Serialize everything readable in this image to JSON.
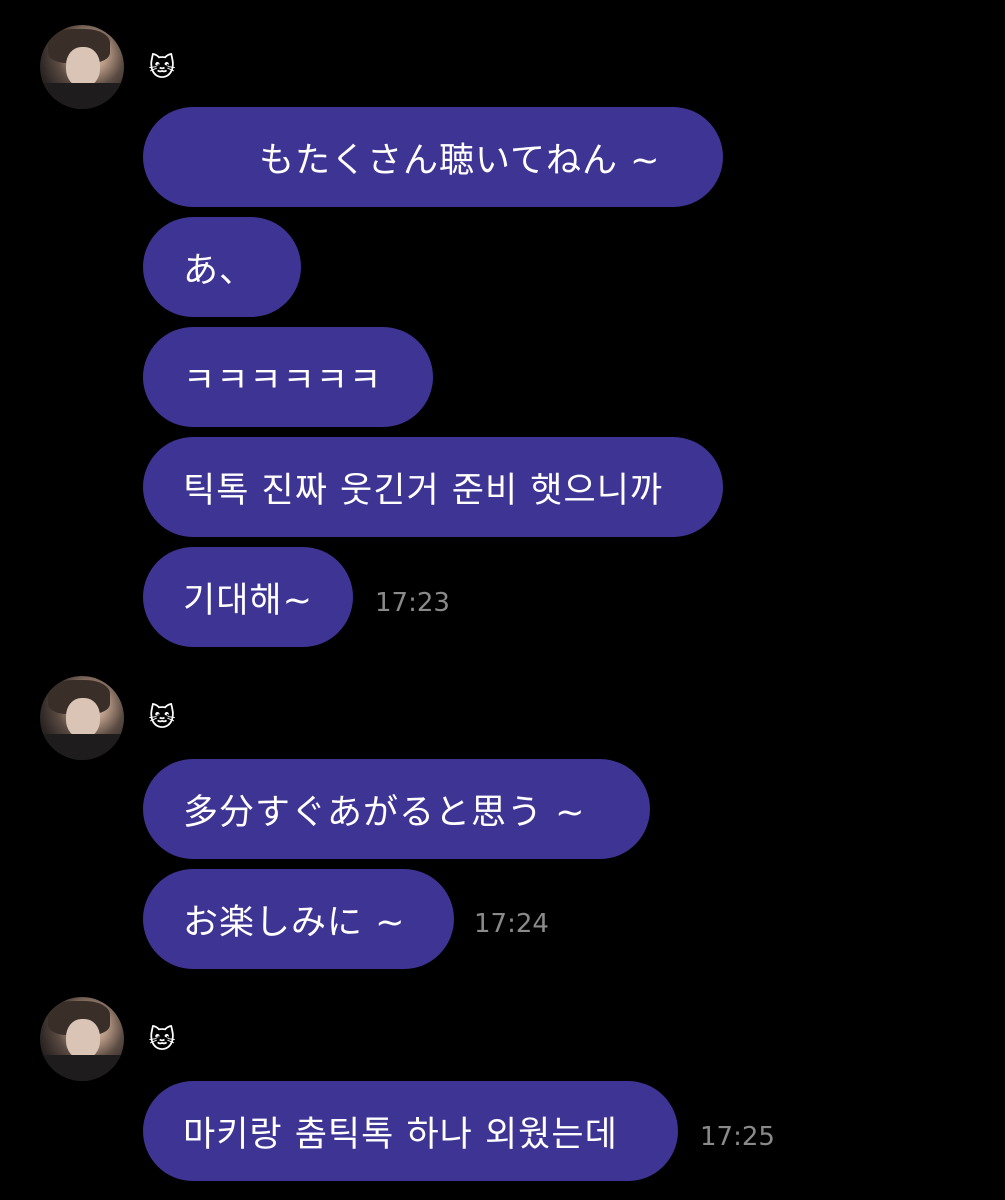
{
  "groups": [
    {
      "sender_icon": "🐱",
      "avatar": "profile-photo",
      "messages": [
        "もたくさん聴いてねん ~",
        "あ、",
        "ㅋㅋㅋㅋㅋㅋ",
        "틱톡 진짜 웃긴거 준비 햇으니까",
        "기대해~"
      ],
      "time": "17:23"
    },
    {
      "sender_icon": "🐱",
      "avatar": "profile-photo",
      "messages": [
        "多分すぐあがると思う ~",
        "お楽しみに ~"
      ],
      "time": "17:24"
    },
    {
      "sender_icon": "🐱",
      "avatar": "profile-photo",
      "messages": [
        "마키랑 춤틱톡 하나 외웠는데"
      ],
      "time": "17:25"
    }
  ],
  "colors": {
    "background": "#000000",
    "bubble": "#3e3493",
    "timestamp": "#8a8a8a"
  }
}
